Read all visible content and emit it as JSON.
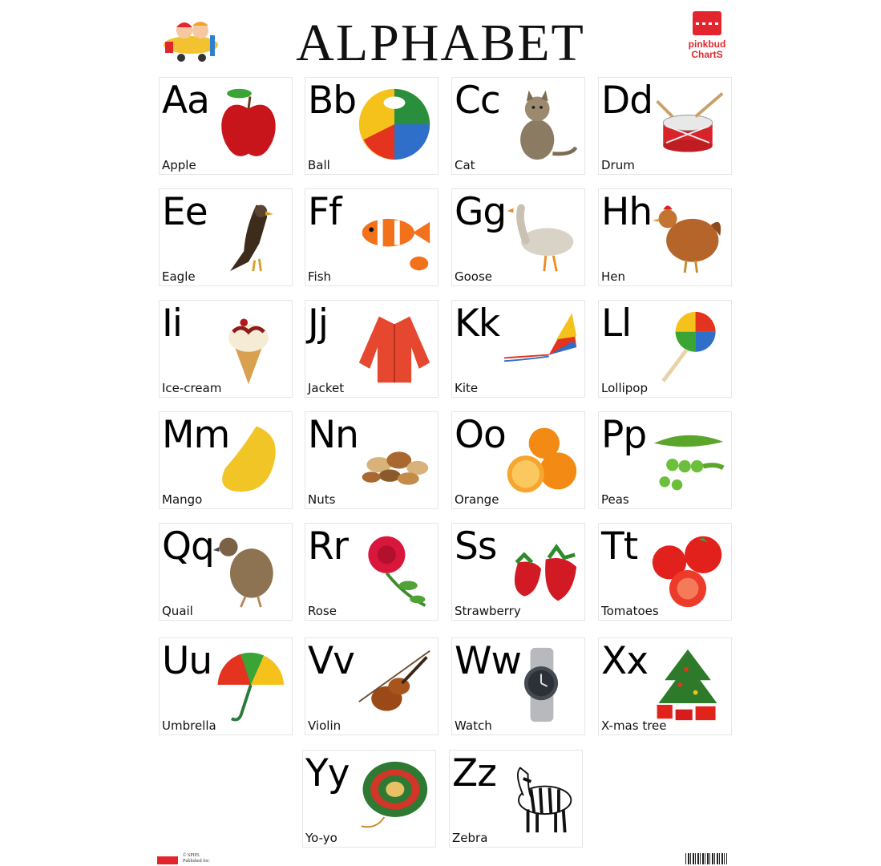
{
  "poster": {
    "title": "ALPHABET",
    "brand": {
      "name": "pinkbud",
      "sub": "ChartS",
      "color": "#e3262d"
    },
    "footer": {
      "line1": "© SPIPL",
      "line2": "Published for:"
    }
  },
  "cards": [
    {
      "letter": "Aa",
      "word": "Apple",
      "icon": "apple-icon"
    },
    {
      "letter": "Bb",
      "word": "Ball",
      "icon": "ball-icon"
    },
    {
      "letter": "Cc",
      "word": "Cat",
      "icon": "cat-icon"
    },
    {
      "letter": "Dd",
      "word": "Drum",
      "icon": "drum-icon"
    },
    {
      "letter": "Ee",
      "word": "Eagle",
      "icon": "eagle-icon"
    },
    {
      "letter": "Ff",
      "word": "Fish",
      "icon": "fish-icon"
    },
    {
      "letter": "Gg",
      "word": "Goose",
      "icon": "goose-icon"
    },
    {
      "letter": "Hh",
      "word": "Hen",
      "icon": "hen-icon"
    },
    {
      "letter": "Ii",
      "word": "Ice-cream",
      "icon": "ice-cream-icon"
    },
    {
      "letter": "Jj",
      "word": "Jacket",
      "icon": "jacket-icon"
    },
    {
      "letter": "Kk",
      "word": "Kite",
      "icon": "kite-icon"
    },
    {
      "letter": "Ll",
      "word": "Lollipop",
      "icon": "lollipop-icon"
    },
    {
      "letter": "Mm",
      "word": "Mango",
      "icon": "mango-icon"
    },
    {
      "letter": "Nn",
      "word": "Nuts",
      "icon": "nuts-icon"
    },
    {
      "letter": "Oo",
      "word": "Orange",
      "icon": "orange-icon"
    },
    {
      "letter": "Pp",
      "word": "Peas",
      "icon": "peas-icon"
    },
    {
      "letter": "Qq",
      "word": "Quail",
      "icon": "quail-icon"
    },
    {
      "letter": "Rr",
      "word": "Rose",
      "icon": "rose-icon"
    },
    {
      "letter": "Ss",
      "word": "Strawberry",
      "icon": "strawberry-icon"
    },
    {
      "letter": "Tt",
      "word": "Tomatoes",
      "icon": "tomatoes-icon"
    },
    {
      "letter": "Uu",
      "word": "Umbrella",
      "icon": "umbrella-icon"
    },
    {
      "letter": "Vv",
      "word": "Violin",
      "icon": "violin-icon"
    },
    {
      "letter": "Ww",
      "word": "Watch",
      "icon": "watch-icon"
    },
    {
      "letter": "Xx",
      "word": "X-mas tree",
      "icon": "xmas-tree-icon"
    },
    {
      "letter": "Yy",
      "word": "Yo-yo",
      "icon": "yo-yo-icon"
    },
    {
      "letter": "Zz",
      "word": "Zebra",
      "icon": "zebra-icon"
    }
  ]
}
